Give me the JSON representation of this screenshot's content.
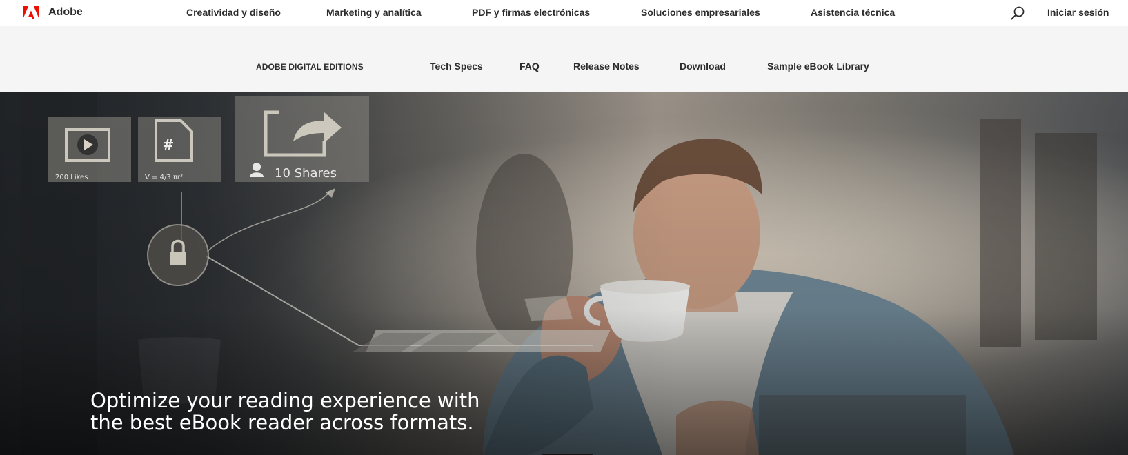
{
  "global_nav": {
    "brand": "Adobe",
    "links": [
      "Creatividad y diseño",
      "Marketing y analítica",
      "PDF y firmas electrónicas",
      "Soluciones empresariales",
      "Asistencia técnica"
    ],
    "search_icon": "search-icon",
    "signin": "Iniciar sesión",
    "brand_color": "#eb1000"
  },
  "sub_nav": {
    "product": "ADOBE DIGITAL EDITIONS",
    "links": [
      "Tech Specs",
      "FAQ",
      "Release Notes",
      "Download",
      "Sample eBook Library"
    ]
  },
  "hero": {
    "headline_line1": "Optimize your reading experience with",
    "headline_line2": "the best eBook reader across formats.",
    "overlay": {
      "likes": "200 Likes",
      "formula": "V = 4/3 πr³",
      "shares": "10 Shares",
      "hash": "#"
    }
  }
}
